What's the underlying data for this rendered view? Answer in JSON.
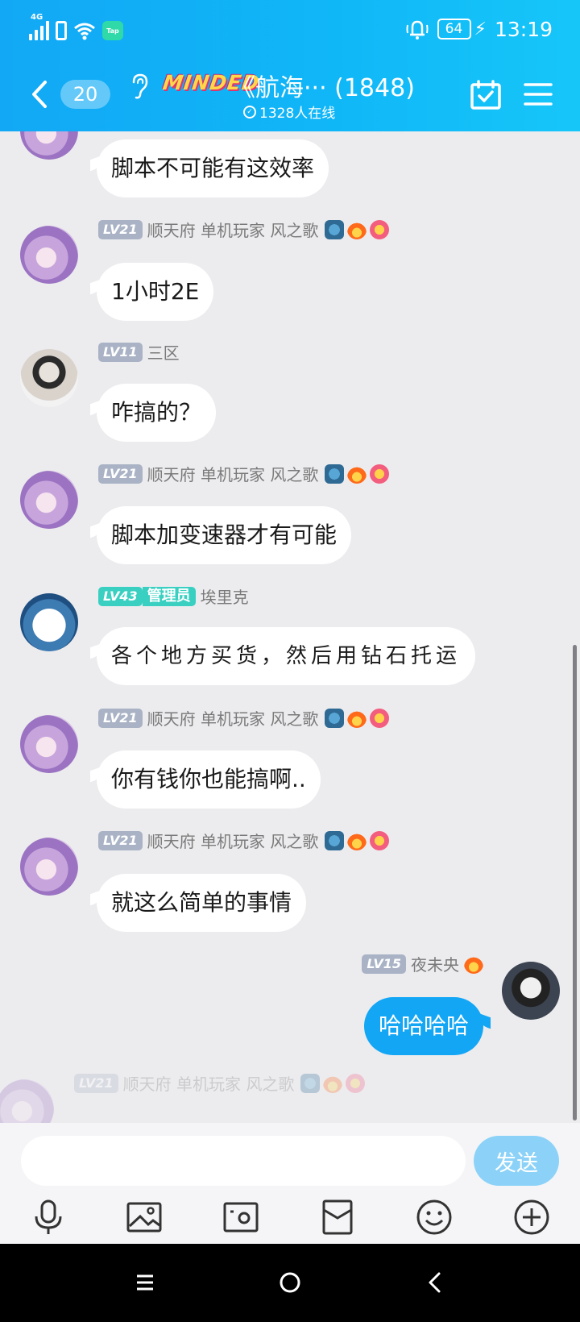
{
  "status_bar": {
    "network": "4G",
    "tap_label": "Tap",
    "battery": "64",
    "time": "13:19"
  },
  "header": {
    "unread_count": "20",
    "brand": "MINDED",
    "title": "《航海··· (1848)",
    "online_text": "1328人在线"
  },
  "messages": [
    {
      "side": "left",
      "avatar": "girl",
      "level": "",
      "name": "",
      "text": "脚本不可能有这效率"
    },
    {
      "side": "left",
      "avatar": "girl",
      "level": "LV21",
      "name": "顺天府 单机玩家 风之歌",
      "badges": [
        "dragon-badge-icon",
        "fire-badge-icon",
        "flower-badge-icon"
      ],
      "text": "1小时2E"
    },
    {
      "side": "left",
      "avatar": "boy",
      "level": "LV11",
      "name": "三区",
      "text": "咋搞的？"
    },
    {
      "side": "left",
      "avatar": "girl",
      "level": "LV21",
      "name": "顺天府 单机玩家 风之歌",
      "text": "脚本加变速器才有可能"
    },
    {
      "side": "left",
      "avatar": "dog",
      "level": "LV43",
      "role": "管理员",
      "name": "埃里克",
      "text": "各个地方买货，然后用钻石托运"
    },
    {
      "side": "left",
      "avatar": "girl",
      "level": "LV21",
      "name": "顺天府 单机玩家 风之歌",
      "text": "你有钱你也能搞啊.."
    },
    {
      "side": "left",
      "avatar": "girl",
      "level": "LV21",
      "name": "顺天府 单机玩家 风之歌",
      "text": "就这么简单的事情"
    },
    {
      "side": "right",
      "avatar": "mask",
      "level": "LV15",
      "name": "夜未央",
      "text": "哈哈哈哈"
    },
    {
      "side": "left",
      "avatar": "girl",
      "level": "LV21",
      "name": "顺天府 单机玩家 风之歌",
      "text": ""
    }
  ],
  "composer": {
    "input_value": "",
    "send_label": "发送"
  },
  "colors": {
    "header": "#12a8f5",
    "my_bubble": "#13a6f5",
    "send_button": "#8cd2f8",
    "admin_badge": "#3ad0c1",
    "level_badge": "#a9b3c5"
  }
}
